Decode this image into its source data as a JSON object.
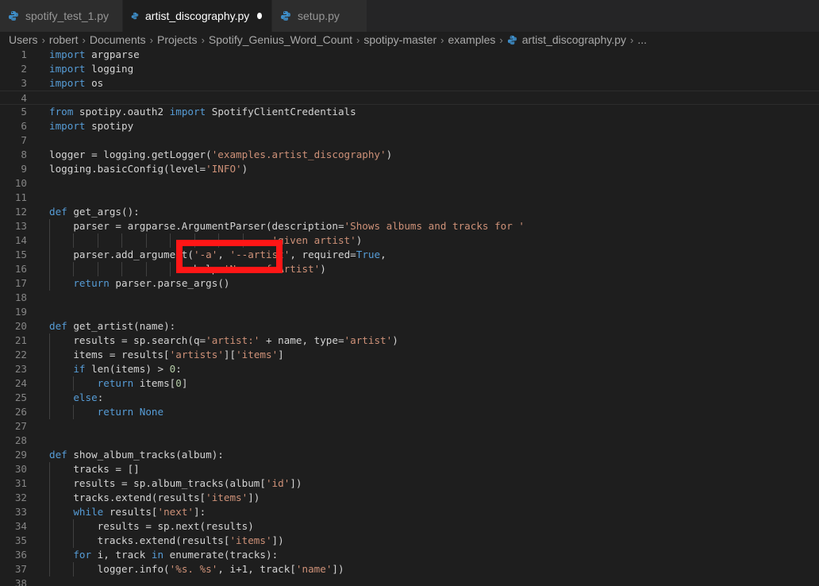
{
  "tabs": [
    {
      "label": "spotify_test_1.py",
      "active": false,
      "modified": false
    },
    {
      "label": "artist_discography.py",
      "active": true,
      "modified": true
    },
    {
      "label": "setup.py",
      "active": false,
      "modified": false
    }
  ],
  "breadcrumb": [
    "Users",
    "robert",
    "Documents",
    "Projects",
    "Spotify_Genius_Word_Count",
    "spotipy-master",
    "examples",
    "artist_discography.py",
    "..."
  ],
  "colors": {
    "keyword": "#569cd6",
    "string": "#ce9178",
    "number": "#b5cea8",
    "text": "#d4d4d4",
    "highlight_box": "#ff1616"
  },
  "highlight": {
    "annotation": "red-rectangle"
  },
  "code_lines": [
    [
      [
        "k",
        "import"
      ],
      [
        "t",
        " argparse"
      ]
    ],
    [
      [
        "k",
        "import"
      ],
      [
        "t",
        " logging"
      ]
    ],
    [
      [
        "k",
        "import"
      ],
      [
        "t",
        " os"
      ]
    ],
    [],
    [
      [
        "k",
        "from"
      ],
      [
        "t",
        " spotipy.oauth2 "
      ],
      [
        "k",
        "import"
      ],
      [
        "t",
        " SpotifyClientCredentials"
      ]
    ],
    [
      [
        "k",
        "import"
      ],
      [
        "t",
        " spotipy"
      ]
    ],
    [],
    [
      [
        "t",
        "logger = logging.getLogger("
      ],
      [
        "s",
        "'examples.artist_discography'"
      ],
      [
        "t",
        ")"
      ]
    ],
    [
      [
        "t",
        "logging.basicConfig(level="
      ],
      [
        "s",
        "'INFO'"
      ],
      [
        "t",
        ")"
      ]
    ],
    [],
    [],
    [
      [
        "k",
        "def"
      ],
      [
        "t",
        " get_args():"
      ]
    ],
    [
      [
        "t",
        "    parser = argparse.ArgumentParser(description="
      ],
      [
        "s",
        "'Shows albums and tracks for '"
      ]
    ],
    [
      [
        "t",
        "                                     "
      ],
      [
        "s",
        "'given artist'"
      ],
      [
        "t",
        ")"
      ]
    ],
    [
      [
        "t",
        "    parser.add_argument("
      ],
      [
        "s",
        "'-a'"
      ],
      [
        "t",
        ", "
      ],
      [
        "s",
        "'--artist'"
      ],
      [
        "t",
        ", required="
      ],
      [
        "k",
        "True"
      ],
      [
        "t",
        ","
      ]
    ],
    [
      [
        "t",
        "                        help="
      ],
      [
        "s",
        "'Name of Artist'"
      ],
      [
        "t",
        ")"
      ]
    ],
    [
      [
        "t",
        "    "
      ],
      [
        "k",
        "return"
      ],
      [
        "t",
        " parser.parse_args()"
      ]
    ],
    [],
    [],
    [
      [
        "k",
        "def"
      ],
      [
        "t",
        " get_artist(name):"
      ]
    ],
    [
      [
        "t",
        "    results = sp.search(q="
      ],
      [
        "s",
        "'artist:'"
      ],
      [
        "t",
        " + name, type="
      ],
      [
        "s",
        "'artist'"
      ],
      [
        "t",
        ")"
      ]
    ],
    [
      [
        "t",
        "    items = results["
      ],
      [
        "s",
        "'artists'"
      ],
      [
        "t",
        "]["
      ],
      [
        "s",
        "'items'"
      ],
      [
        "t",
        "]"
      ]
    ],
    [
      [
        "t",
        "    "
      ],
      [
        "k",
        "if"
      ],
      [
        "t",
        " len(items) > "
      ],
      [
        "n",
        "0"
      ],
      [
        "t",
        ":"
      ]
    ],
    [
      [
        "t",
        "        "
      ],
      [
        "k",
        "return"
      ],
      [
        "t",
        " items["
      ],
      [
        "n",
        "0"
      ],
      [
        "t",
        "]"
      ]
    ],
    [
      [
        "t",
        "    "
      ],
      [
        "k",
        "else"
      ],
      [
        "t",
        ":"
      ]
    ],
    [
      [
        "t",
        "        "
      ],
      [
        "k",
        "return"
      ],
      [
        "t",
        " "
      ],
      [
        "k",
        "None"
      ]
    ],
    [],
    [],
    [
      [
        "k",
        "def"
      ],
      [
        "t",
        " show_album_tracks(album):"
      ]
    ],
    [
      [
        "t",
        "    tracks = []"
      ]
    ],
    [
      [
        "t",
        "    results = sp.album_tracks(album["
      ],
      [
        "s",
        "'id'"
      ],
      [
        "t",
        "])"
      ]
    ],
    [
      [
        "t",
        "    tracks.extend(results["
      ],
      [
        "s",
        "'items'"
      ],
      [
        "t",
        "])"
      ]
    ],
    [
      [
        "t",
        "    "
      ],
      [
        "k",
        "while"
      ],
      [
        "t",
        " results["
      ],
      [
        "s",
        "'next'"
      ],
      [
        "t",
        "]:"
      ]
    ],
    [
      [
        "t",
        "        results = sp.next(results)"
      ]
    ],
    [
      [
        "t",
        "        tracks.extend(results["
      ],
      [
        "s",
        "'items'"
      ],
      [
        "t",
        "])"
      ]
    ],
    [
      [
        "t",
        "    "
      ],
      [
        "k",
        "for"
      ],
      [
        "t",
        " i, track "
      ],
      [
        "k",
        "in"
      ],
      [
        "t",
        " enumerate(tracks):"
      ]
    ],
    [
      [
        "t",
        "        logger.info("
      ],
      [
        "s",
        "'%s. %s'"
      ],
      [
        "t",
        ", i+1, track["
      ],
      [
        "s",
        "'name'"
      ],
      [
        "t",
        "])"
      ]
    ],
    []
  ]
}
